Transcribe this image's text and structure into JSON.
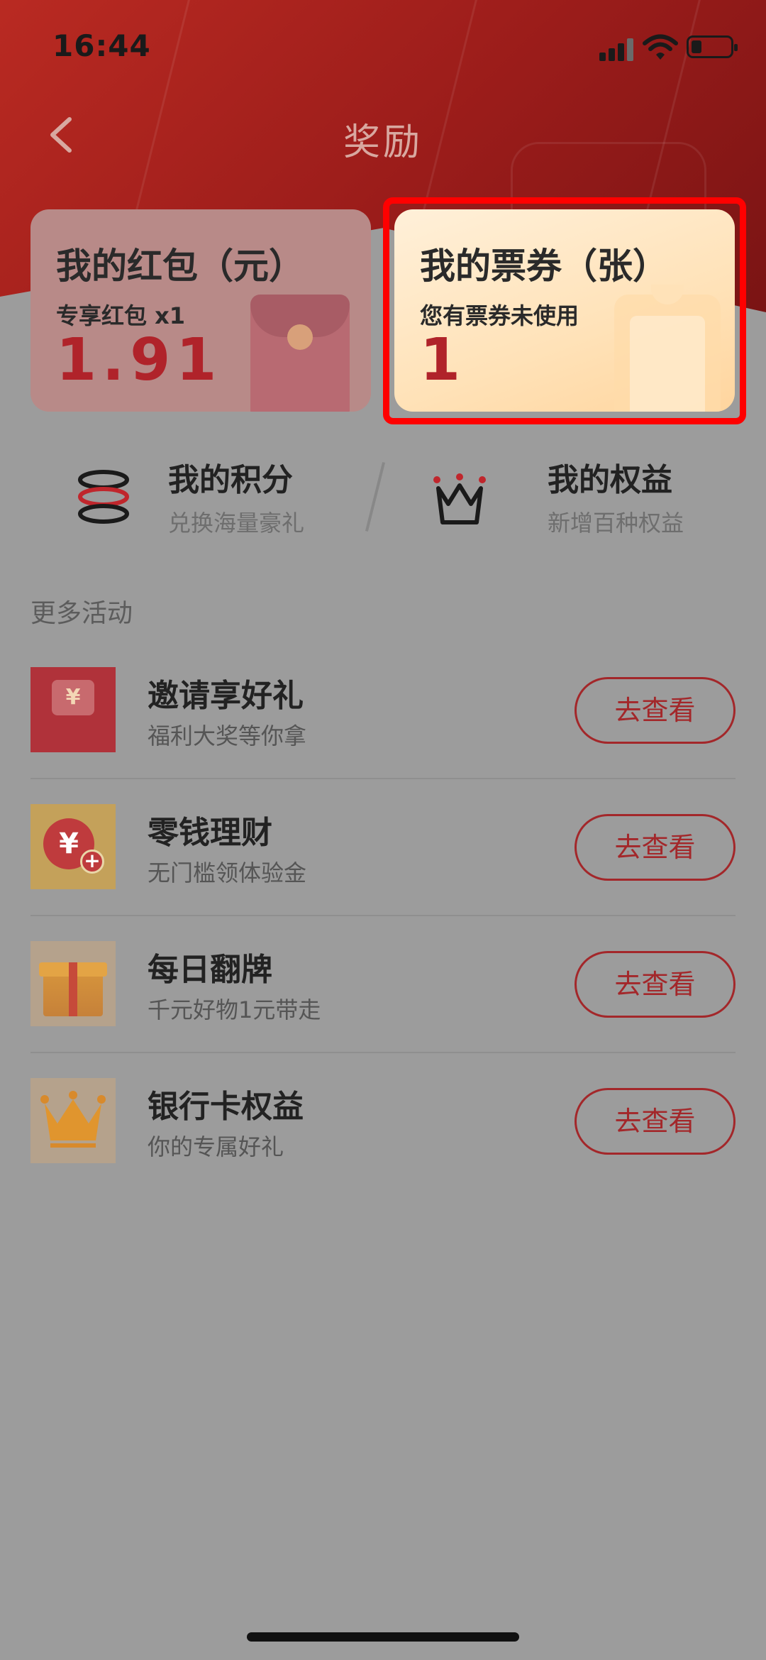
{
  "status_bar": {
    "time": "16:44"
  },
  "nav": {
    "title": "奖励"
  },
  "cards": {
    "red_packet": {
      "title": "我的红包（元）",
      "subtitle": "专享红包 x1",
      "value": "1.91"
    },
    "tickets": {
      "title": "我的票券（张）",
      "subtitle": "您有票券未使用",
      "value": "1"
    }
  },
  "quick_links": {
    "points": {
      "title": "我的积分",
      "subtitle": "兑换海量豪礼"
    },
    "rights": {
      "title": "我的权益",
      "subtitle": "新增百种权益"
    }
  },
  "more": {
    "section_title": "更多活动",
    "items": [
      {
        "title": "邀请享好礼",
        "subtitle": "福利大奖等你拿",
        "button": "去查看"
      },
      {
        "title": "零钱理财",
        "subtitle": "无门槛领体验金",
        "button": "去查看"
      },
      {
        "title": "每日翻牌",
        "subtitle": "千元好物1元带走",
        "button": "去查看"
      },
      {
        "title": "银行卡权益",
        "subtitle": "你的专属好礼",
        "button": "去查看"
      }
    ]
  },
  "thumb_text": {
    "yen": "¥"
  },
  "colors": {
    "brand_red": "#a3272a",
    "value_red": "#b0232a",
    "header_red": "#9a1c1a"
  }
}
